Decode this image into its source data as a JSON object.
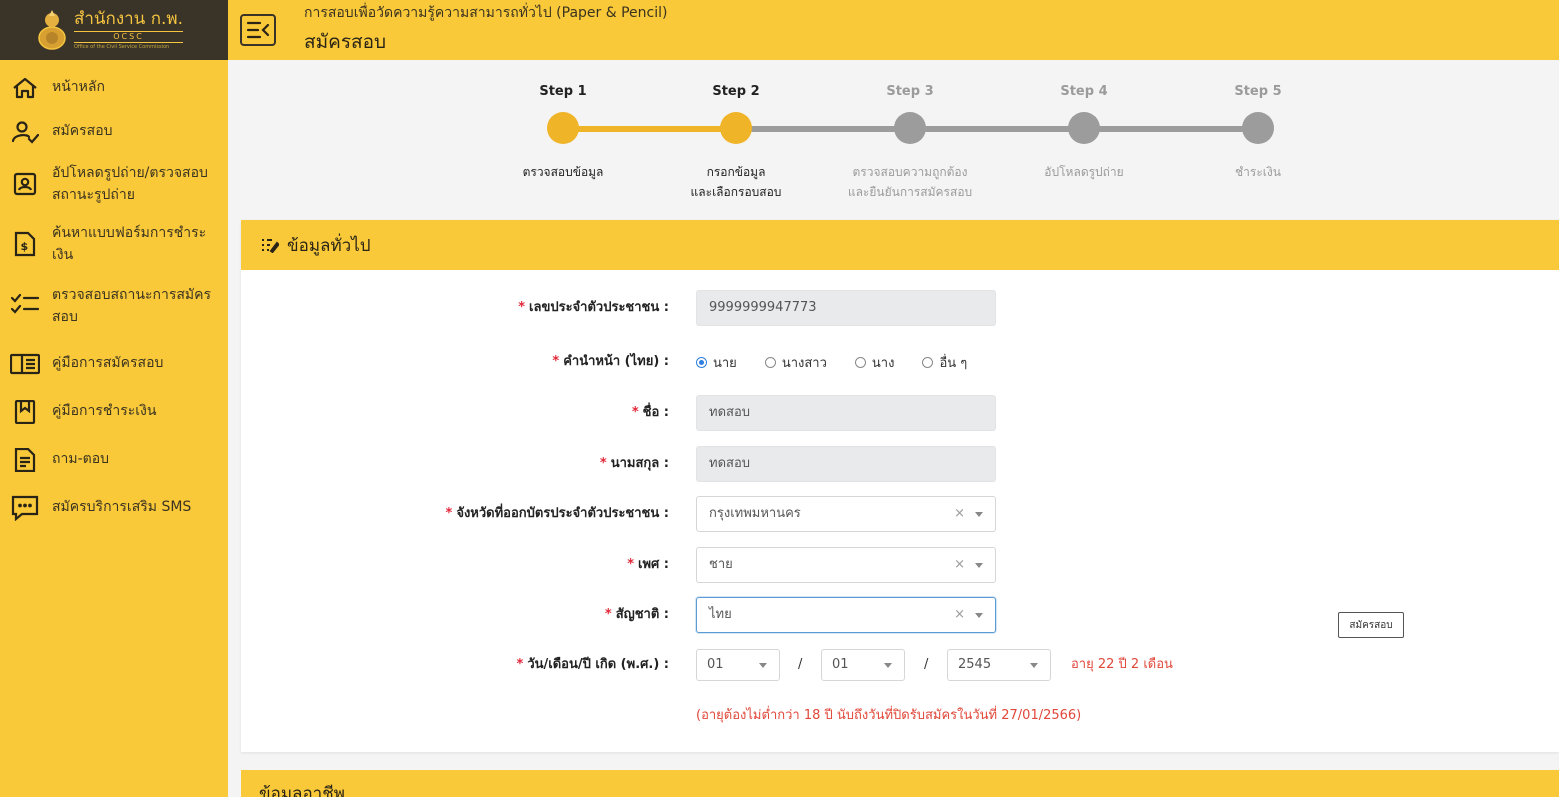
{
  "logo": {
    "thai_name": "สำนักงาน ก.พ.",
    "abbr": "OCSC",
    "english": "Office of the Civil Service Commission"
  },
  "sidebar": {
    "items": [
      {
        "label": "หน้าหลัก",
        "icon": "home-icon"
      },
      {
        "label": "สมัครสอบ",
        "icon": "user-check-icon"
      },
      {
        "label": "อัปโหลดรูปถ่าย/ตรวจสอบสถานะรูปถ่าย",
        "icon": "photo-id-icon"
      },
      {
        "label": "ค้นหาแบบฟอร์มการชำระเงิน",
        "icon": "payment-document-icon"
      },
      {
        "label": "ตรวจสอบสถานะการสมัครสอบ",
        "icon": "checklist-icon"
      },
      {
        "label": "คู่มือการสมัครสอบ",
        "icon": "book-icon"
      },
      {
        "label": "คู่มือการชำระเงิน",
        "icon": "bookmark-icon"
      },
      {
        "label": "ถาม-ตอบ",
        "icon": "document-icon"
      },
      {
        "label": "สมัครบริการเสริม SMS",
        "icon": "chat-icon"
      }
    ]
  },
  "header": {
    "subtitle": "การสอบเพื่อวัดความรู้ความสามารถทั่วไป (Paper & Pencil)",
    "title": "สมัครสอบ"
  },
  "steps": [
    {
      "title": "Step 1",
      "line1": "ตรวจสอบข้อมูล",
      "line2": "",
      "state": "active"
    },
    {
      "title": "Step 2",
      "line1": "กรอกข้อมูล",
      "line2": "และเลือกรอบสอบ",
      "state": "active"
    },
    {
      "title": "Step 3",
      "line1": "ตรวจสอบความถูกต้อง",
      "line2": "และยืนยันการสมัครสอบ",
      "state": "inactive"
    },
    {
      "title": "Step 4",
      "line1": "อัปโหลดรูปถ่าย",
      "line2": "",
      "state": "inactive"
    },
    {
      "title": "Step 5",
      "line1": "ชำระเงิน",
      "line2": "",
      "state": "inactive"
    }
  ],
  "colors": {
    "accent": "#f9c93a",
    "step_active": "#f0b429",
    "step_inactive": "#9c9c9c",
    "required": "#e0283a",
    "warning_text": "#e0483a",
    "sidebar_dark": "#3a3328"
  },
  "form": {
    "section_title": "ข้อมูลทั่วไป",
    "section_icon": "list-edit-icon",
    "id_card": {
      "label": "เลขประจำตัวประชาชน :",
      "value": "9999999947773"
    },
    "title_prefix": {
      "label": "คำนำหน้า (ไทย) :",
      "options": [
        "นาย",
        "นางสาว",
        "นาง",
        "อื่น ๆ"
      ],
      "selected": "นาย"
    },
    "first_name": {
      "label": "ชื่อ :",
      "value": "ทดสอบ"
    },
    "last_name": {
      "label": "นามสกุล :",
      "value": "ทดสอบ"
    },
    "province": {
      "label": "จังหวัดที่ออกบัตรประจำตัวประชาชน :",
      "value": "กรุงเทพมหานคร"
    },
    "gender": {
      "label": "เพศ :",
      "value": "ชาย"
    },
    "nationality": {
      "label": "สัญชาติ :",
      "value": "ไทย"
    },
    "birthdate": {
      "label": "วัน/เดือน/ปี เกิด (พ.ศ.) :",
      "day": "01",
      "month": "01",
      "year": "2545",
      "separator": "/",
      "age": "อายุ 22 ปี 2 เดือน"
    },
    "clear_symbol": "×",
    "required_mark": "*",
    "age_note": "(อายุต้องไม่ต่ำกว่า 18 ปี นับถึงวันที่ปิดรับสมัครในวันที่ 27/01/2566)"
  },
  "apply_button": "สมัครสอบ",
  "next_section_title": "ข้อมูลอาชีพ"
}
